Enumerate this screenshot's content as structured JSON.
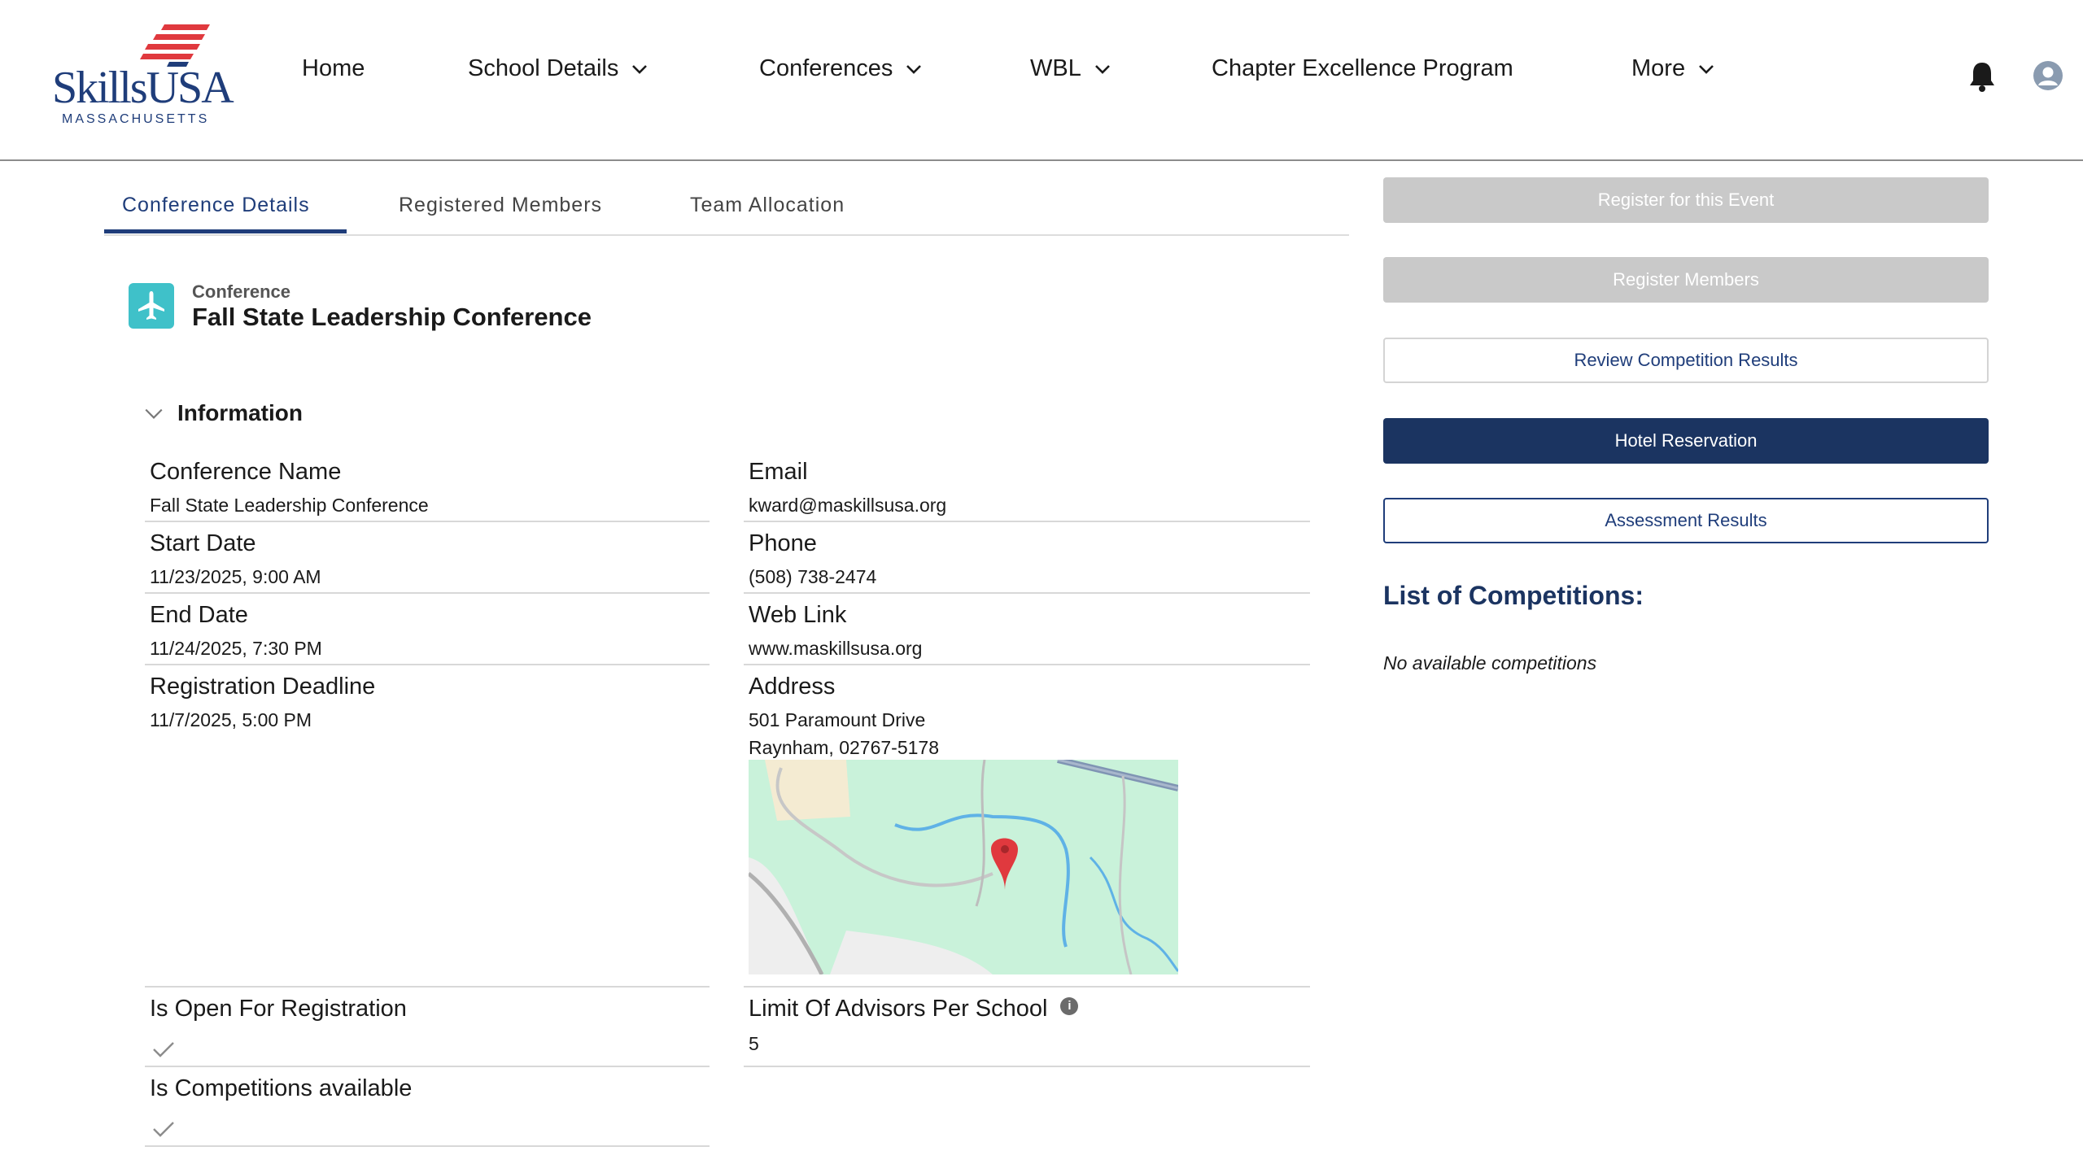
{
  "brand": {
    "logo_text": "SkillsUSA",
    "logo_subtext": "MASSACHUSETTS",
    "logo_colors": {
      "blue": "#1f3d7a",
      "red": "#e0393e"
    }
  },
  "nav": {
    "home": "Home",
    "school_details": "School Details",
    "conferences": "Conferences",
    "wbl": "WBL",
    "chapter_excellence": "Chapter Excellence Program",
    "more": "More",
    "icons": {
      "notifications": "bell-icon",
      "user": "user-avatar-icon",
      "dropdown": "chevron-down-icon"
    }
  },
  "tabs": {
    "conference_details": "Conference Details",
    "registered_members": "Registered Members",
    "team_allocation": "Team Allocation",
    "active": "Conference Details"
  },
  "record": {
    "type_label": "Conference",
    "title": "Fall State Leadership Conference",
    "icon": "airplane-icon",
    "icon_color": "#3fc1c9"
  },
  "section": {
    "title": "Information"
  },
  "fields": {
    "conference_name": {
      "label": "Conference Name",
      "value": "Fall State Leadership Conference"
    },
    "email": {
      "label": "Email",
      "value": "kward@maskillsusa.org"
    },
    "start_date": {
      "label": "Start Date",
      "value": "11/23/2025, 9:00 AM"
    },
    "phone": {
      "label": "Phone",
      "value": "(508) 738-2474"
    },
    "end_date": {
      "label": "End Date",
      "value": "11/24/2025, 7:30 PM"
    },
    "web_link": {
      "label": "Web Link",
      "value": "www.maskillsusa.org"
    },
    "registration_deadline": {
      "label": "Registration Deadline",
      "value": "11/7/2025, 5:00 PM"
    },
    "address": {
      "label": "Address",
      "line1": "501 Paramount Drive",
      "line2": "Raynham, 02767-5178"
    },
    "is_open": {
      "label": "Is Open For Registration",
      "checked": true
    },
    "limit_advisors": {
      "label": "Limit Of Advisors Per School",
      "value": "5",
      "info_glyph": "i"
    },
    "is_competitions": {
      "label": "Is Competitions available",
      "checked": true
    }
  },
  "actions": {
    "register_event": "Register for this Event",
    "register_members": "Register Members",
    "review_results": "Review Competition Results",
    "hotel_reservation": "Hotel Reservation",
    "assessment_results": "Assessment Results"
  },
  "competitions": {
    "title": "List of Competitions:",
    "empty_text": "No available competitions"
  },
  "colors": {
    "accent": "#1f3d7a",
    "primary_button": "#1b3461",
    "disabled_button": "#c9c9c9",
    "map_green": "#c9f2da",
    "map_pin": "#e0393e"
  }
}
